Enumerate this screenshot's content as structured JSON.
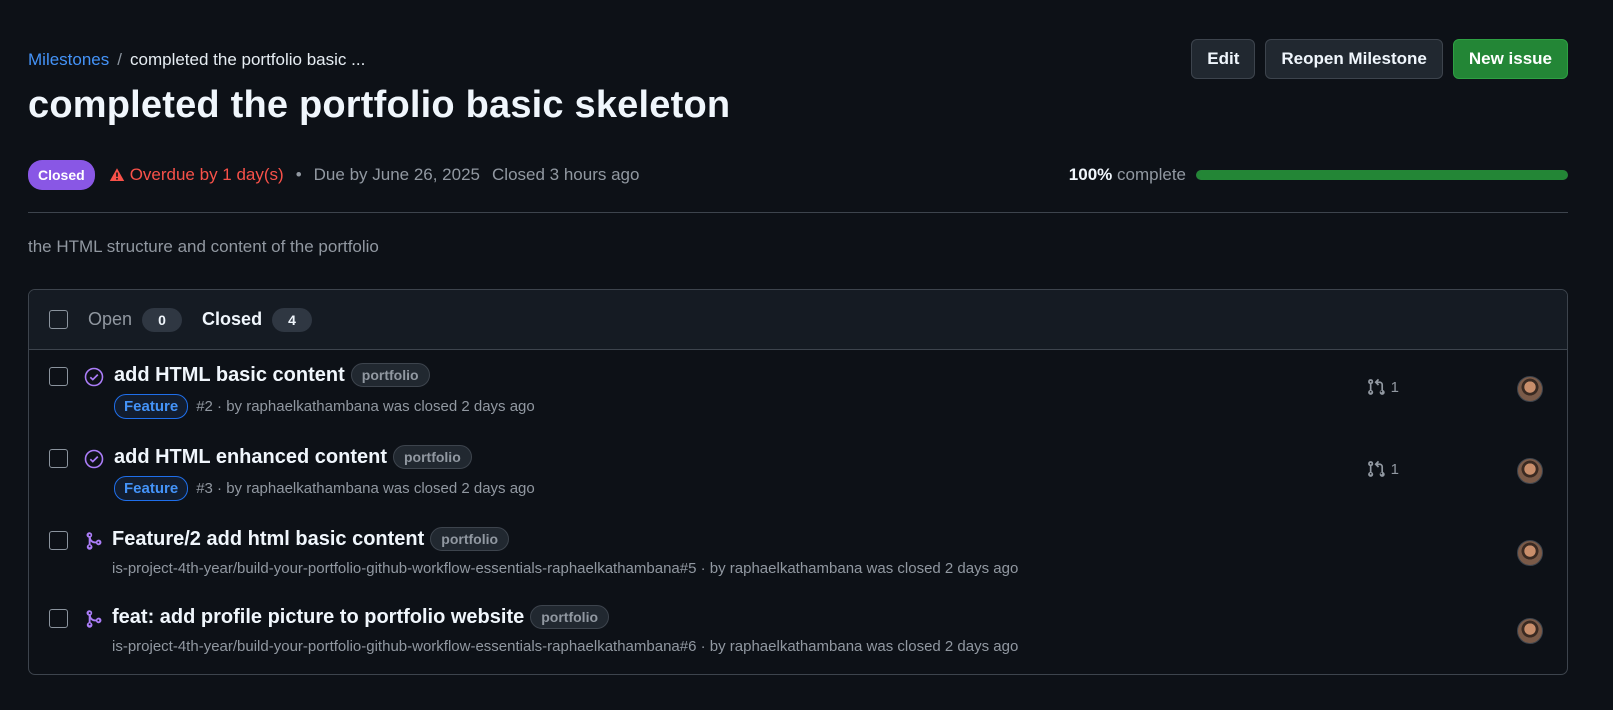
{
  "breadcrumb": {
    "root": "Milestones",
    "separator": "/",
    "current": "completed the portfolio basic ..."
  },
  "title": "completed the portfolio basic skeleton",
  "actions": {
    "edit": "Edit",
    "reopen": "Reopen Milestone",
    "new_issue": "New issue"
  },
  "meta": {
    "state": "Closed",
    "overdue": "Overdue by 1 day(s)",
    "bullet": "•",
    "due": "Due by June 26, 2025",
    "closed": "Closed 3 hours ago"
  },
  "progress": {
    "percent_label": "100%",
    "suffix": "complete",
    "value": 1.0
  },
  "description": "the HTML structure and content of the portfolio",
  "tabs": {
    "open": {
      "label": "Open",
      "count": "0"
    },
    "closed": {
      "label": "Closed",
      "count": "4"
    }
  },
  "items": [
    {
      "title": "add HTML basic content",
      "label": "portfolio",
      "type": "Feature",
      "meta": "#2 · by raphaelkathambana was closed 2 days ago",
      "linked_prs": "1"
    },
    {
      "title": "add HTML enhanced content",
      "label": "portfolio",
      "type": "Feature",
      "meta": "#3 · by raphaelkathambana was closed 2 days ago",
      "linked_prs": "1"
    },
    {
      "title": "Feature/2 add html basic content",
      "label": "portfolio",
      "meta": "is-project-4th-year/build-your-portfolio-github-workflow-essentials-raphaelkathambana#5 · by raphaelkathambana was closed 2 days ago"
    },
    {
      "title": "feat: add profile picture to portfolio website",
      "label": "portfolio",
      "meta": "is-project-4th-year/build-your-portfolio-github-workflow-essentials-raphaelkathambana#6 · by raphaelkathambana was closed 2 days ago"
    }
  ],
  "colors": {
    "accent": "#4493f8",
    "danger": "#f85149",
    "done": "#8957e5",
    "success": "#238636"
  }
}
